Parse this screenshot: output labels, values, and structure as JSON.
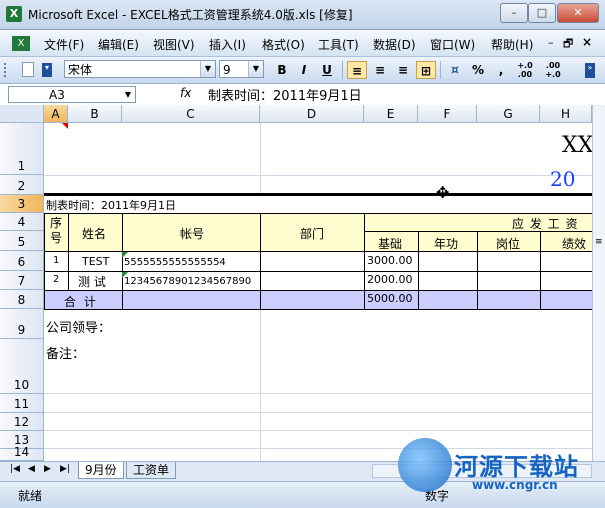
{
  "window": {
    "title": "Microsoft Excel - EXCEL格式工资管理系统4.0版.xls  [修复]",
    "app_icon_label": "X"
  },
  "menu": [
    "文件(F)",
    "编辑(E)",
    "视图(V)",
    "插入(I)",
    "格式(O)",
    "工具(T)",
    "数据(D)",
    "窗口(W)",
    "帮助(H)"
  ],
  "toolbar": {
    "font_name": "宋体",
    "font_size": "9",
    "bold": "B",
    "italic": "I",
    "underline": "U",
    "percent": "%",
    "comma": ",",
    "inc_decimal": "+.0\n.00",
    "dec_decimal": ".00\n+.0"
  },
  "formula_bar": {
    "name_box": "A3",
    "fx_label": "fx",
    "content": "制表时间：2011年9月1日"
  },
  "columns": [
    "A",
    "B",
    "C",
    "D",
    "E",
    "F",
    "G",
    "H"
  ],
  "rows": [
    "1",
    "2",
    "3",
    "4",
    "5",
    "6",
    "7",
    "8",
    "9",
    "10",
    "11",
    "12",
    "13",
    "14"
  ],
  "cells": {
    "h1": "XX",
    "h2": "20",
    "a3": "制表时间：2011年9月1日",
    "seq_header": "序\n号",
    "name_header": "姓名",
    "account_header": "帐号",
    "dept_header": "部门",
    "pay_header": "应 发 工 资",
    "base_header": "基础",
    "seniority_header": "年功",
    "post_header": "岗位",
    "perf_header": "绩效",
    "r6_seq": "1",
    "r6_name": "TEST",
    "r6_account": "5555555555555554",
    "r6_base": "3000.00",
    "r7_seq": "2",
    "r7_name": "测 试",
    "r7_account": "12345678901234567890",
    "r7_base": "2000.00",
    "total_label": "合 计",
    "total_base": "5000.00",
    "leader": "公司领导：",
    "remark": "备注："
  },
  "sheet_tabs": [
    "9月份",
    "工资单"
  ],
  "status": {
    "left": "就绪",
    "num": "数字"
  },
  "watermark": {
    "name": "河源下载站",
    "url": "www.cngr.cn"
  },
  "colors": {
    "header_yellow": "#fffdd0",
    "total_blue": "#ccccff",
    "selected_header": "#f2b65a",
    "h2_blue": "#1a3fff"
  }
}
